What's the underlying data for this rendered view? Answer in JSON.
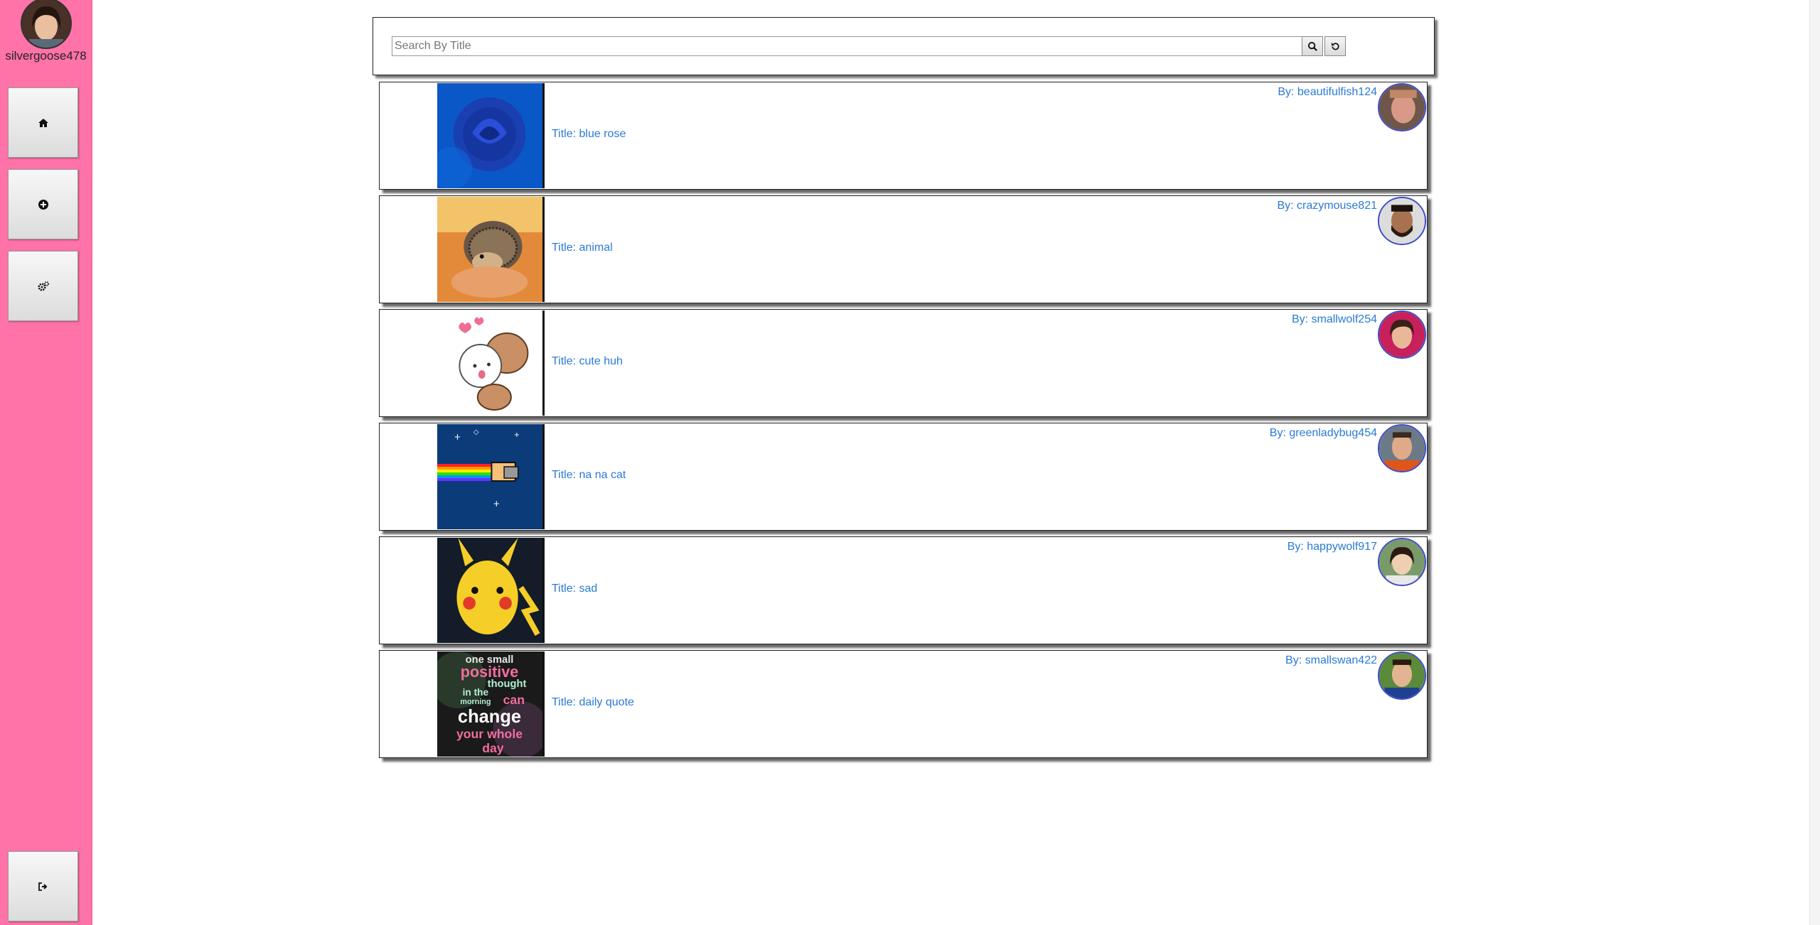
{
  "sidebar": {
    "username": "silvergoose478",
    "buttons": [
      {
        "name": "home",
        "icon": "home-icon"
      },
      {
        "name": "add",
        "icon": "plus-circle-icon"
      },
      {
        "name": "settings",
        "icon": "gears-icon"
      },
      {
        "name": "logout",
        "icon": "sign-out-icon"
      }
    ]
  },
  "search": {
    "placeholder": "Search By Title",
    "value": "",
    "search_icon": "search-icon",
    "reset_icon": "refresh-icon"
  },
  "posts": [
    {
      "title": "Title: blue rose",
      "author": "By: beautifulfish124"
    },
    {
      "title": "Title: animal",
      "author": "By: crazymouse821"
    },
    {
      "title": "Title: cute huh",
      "author": "By: smallwolf254"
    },
    {
      "title": "Title: na na cat",
      "author": "By: greenladybug454"
    },
    {
      "title": "Title: sad",
      "author": "By: happywolf917"
    },
    {
      "title": "Title: daily quote",
      "author": "By: smallswan422"
    }
  ],
  "quote_image_text": [
    "one small",
    "positive",
    "thought",
    "in the",
    "morning",
    "can",
    "change",
    "your whole",
    "day"
  ],
  "colors": {
    "sidebar": "#ff73a8",
    "link": "#2a7ad6",
    "avatar_border": "#3b4bc8"
  }
}
